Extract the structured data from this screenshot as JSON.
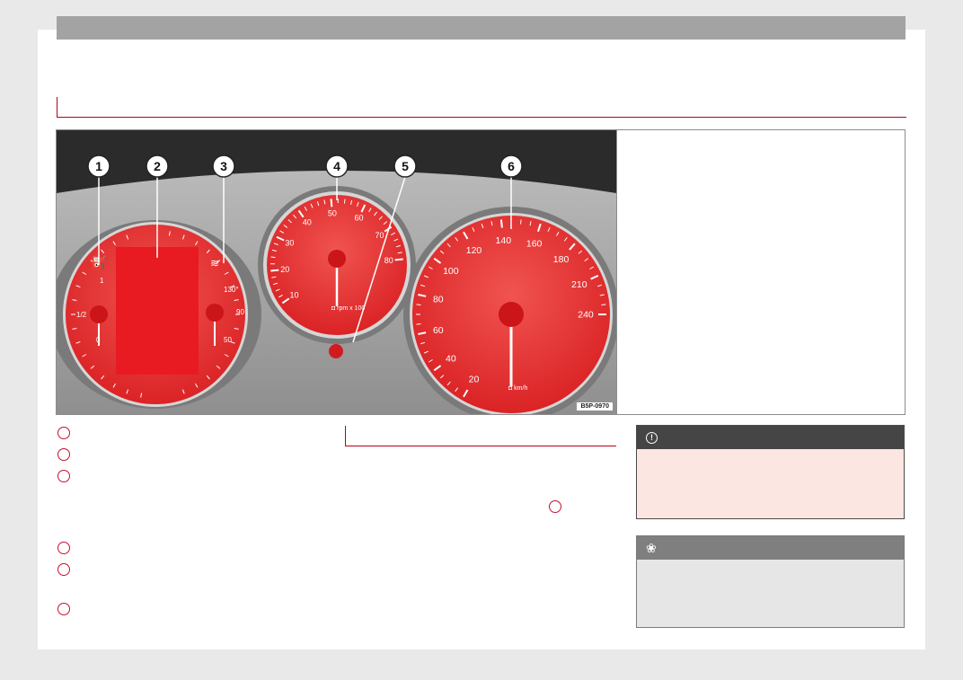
{
  "figure": {
    "code": "B5P-0970",
    "callouts": [
      "1",
      "2",
      "3",
      "4",
      "5",
      "6"
    ],
    "tachometer": {
      "ticks": [
        "10",
        "20",
        "30",
        "40",
        "50",
        "60",
        "70",
        "80"
      ],
      "unit": "rpm x 100"
    },
    "speedometer": {
      "ticks": [
        "20",
        "40",
        "60",
        "80",
        "100",
        "120",
        "140",
        "160",
        "180",
        "210",
        "240"
      ],
      "unit": "km/h"
    },
    "fuel_gauge": {
      "ticks": [
        "1/2",
        "0",
        "1"
      ]
    },
    "temp_gauge": {
      "ticks": [
        "130°",
        "90",
        "50"
      ]
    }
  },
  "legend": {
    "item_count": 6
  },
  "notes": {
    "warning": {
      "icon": "exclamation-circle-icon",
      "symbol": "!"
    },
    "environment": {
      "icon": "flower-icon",
      "symbol": "❀"
    }
  },
  "colors": {
    "accent": "#c8102e",
    "gauge_red": "#e8302e"
  }
}
